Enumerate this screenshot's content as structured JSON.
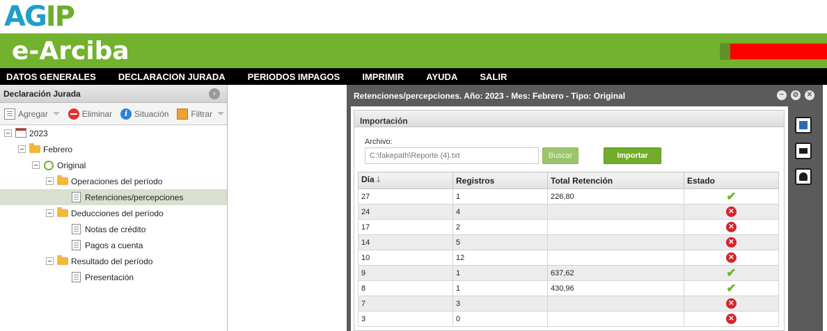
{
  "header": {
    "logo_prefix": "AG",
    "logo_suffix": "IP",
    "app_title": "e-Arciba",
    "colors": {
      "brand_green": "#72b22e",
      "logo_blue": "#1f9ec9",
      "alert_red": "#ff0000"
    }
  },
  "menu": [
    "DATOS GENERALES",
    "DECLARACION JURADA",
    "PERIODOS IMPAGOS",
    "IMPRIMIR",
    "AYUDA",
    "SALIR"
  ],
  "left_panel": {
    "title": "Declaración Jurada",
    "toolbar": {
      "agregar": "Agregar",
      "eliminar": "Eliminar",
      "situacion": "Situación",
      "filtrar": "Filtrar"
    },
    "tree": [
      {
        "label": "2023",
        "icon": "calendar-icon"
      },
      {
        "label": "Febrero",
        "icon": "folder-icon"
      },
      {
        "label": "Original",
        "icon": "original-icon"
      },
      {
        "label": "Operaciones del período",
        "icon": "folder-icon"
      },
      {
        "label": "Retenciones/percepciones",
        "icon": "document-icon",
        "selected": true
      },
      {
        "label": "Deducciones del período",
        "icon": "folder-icon"
      },
      {
        "label": "Notas de crédito",
        "icon": "document-icon"
      },
      {
        "label": "Pagos a cuenta",
        "icon": "document-icon"
      },
      {
        "label": "Resultado del período",
        "icon": "folder-icon"
      },
      {
        "label": "Presentación",
        "icon": "document-icon"
      }
    ]
  },
  "window": {
    "title": "Retenciones/percepciones. Año: 2023 - Mes: Febrero - Tipo: Original",
    "panel_title": "Importación",
    "archivo_label": "Archivo:",
    "archivo_value": "C:\\fakepath\\Reporte (4).txt",
    "buscar_label": "Buscar",
    "importar_label": "Importar",
    "columns": [
      "Día",
      "Registros",
      "Total Retención",
      "Estado"
    ],
    "rows": [
      {
        "dia": "27",
        "registros": "1",
        "total": "226,80",
        "estado": "ok"
      },
      {
        "dia": "24",
        "registros": "4",
        "total": "",
        "estado": "error"
      },
      {
        "dia": "17",
        "registros": "2",
        "total": "",
        "estado": "error"
      },
      {
        "dia": "14",
        "registros": "5",
        "total": "",
        "estado": "error"
      },
      {
        "dia": "10",
        "registros": "12",
        "total": "",
        "estado": "error"
      },
      {
        "dia": "9",
        "registros": "1",
        "total": "637,62",
        "estado": "ok"
      },
      {
        "dia": "8",
        "registros": "1",
        "total": "430,96",
        "estado": "ok"
      },
      {
        "dia": "7",
        "registros": "3",
        "total": "",
        "estado": "error"
      },
      {
        "dia": "3",
        "registros": "0",
        "total": "",
        "estado": "error"
      }
    ],
    "status_colors": {
      "ok": "#6cb52e",
      "error": "#d4262a"
    }
  }
}
